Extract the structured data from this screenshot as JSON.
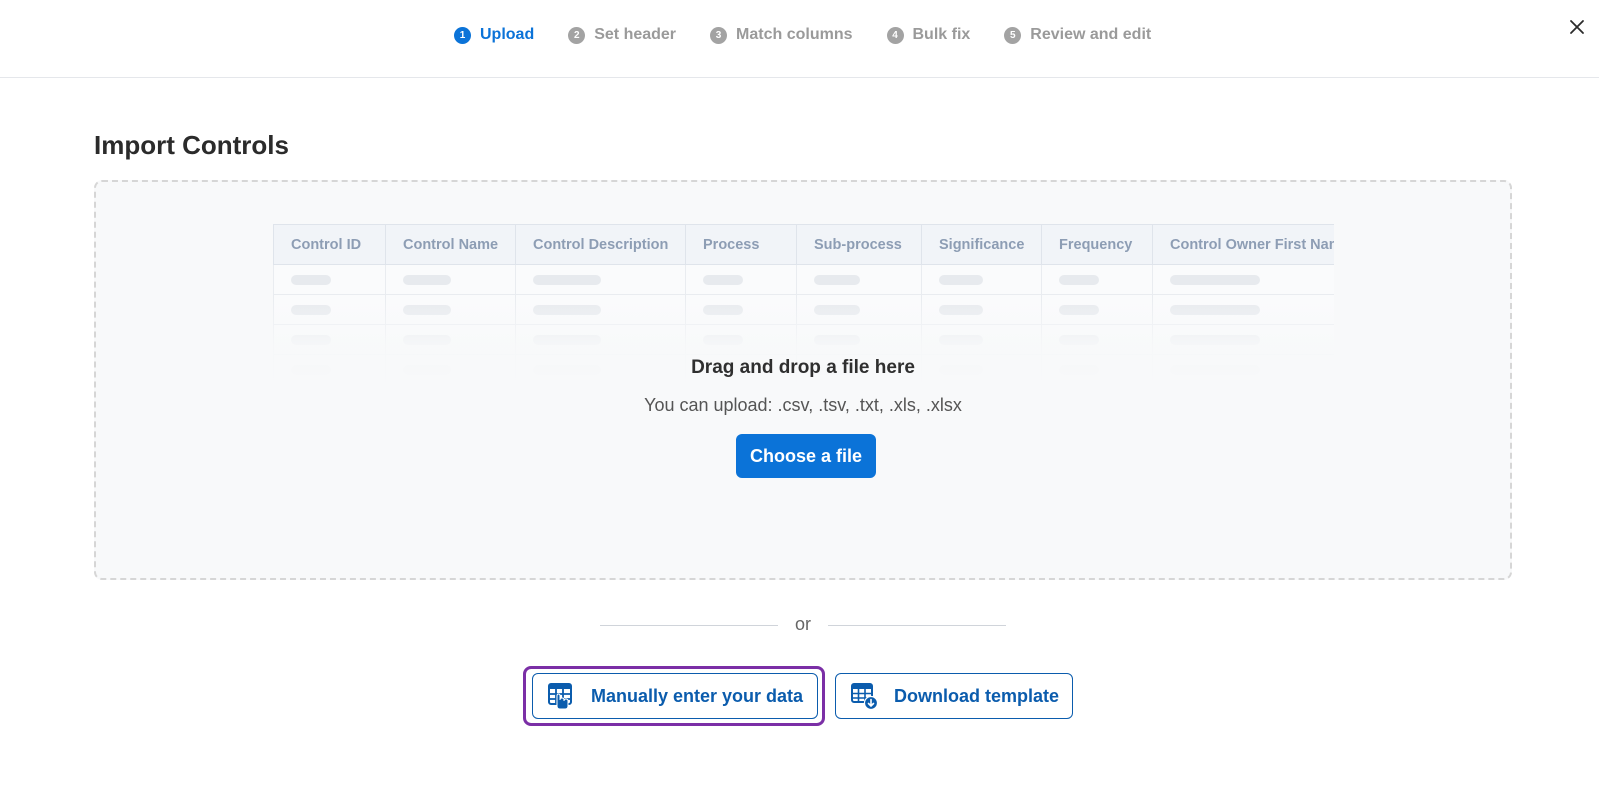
{
  "stepper": {
    "steps": [
      {
        "num": "1",
        "label": "Upload"
      },
      {
        "num": "2",
        "label": "Set header"
      },
      {
        "num": "3",
        "label": "Match columns"
      },
      {
        "num": "4",
        "label": "Bulk fix"
      },
      {
        "num": "5",
        "label": "Review and edit"
      }
    ],
    "active_step": 1
  },
  "page": {
    "title": "Import Controls"
  },
  "dropzone": {
    "title": "Drag and drop a file here",
    "subtitle": "You can upload: .csv, .tsv, .txt, .xls, .xlsx",
    "choose_button": "Choose a file",
    "preview_columns": [
      "Control ID",
      "Control Name",
      "Control Description",
      "Process",
      "Sub-process",
      "Significance",
      "Frequency",
      "Control Owner First Name"
    ]
  },
  "divider": {
    "text": "or"
  },
  "actions": {
    "manual_label": "Manually enter your data",
    "download_label": "Download template"
  },
  "icons": {
    "close": "close-icon",
    "manual": "table-hand-icon",
    "download": "table-download-icon"
  },
  "colors": {
    "primary": "#0b73d8",
    "outline_button": "#0b5cad",
    "focus_ring": "#7b2fa6",
    "inactive_step": "#9a9a9a"
  }
}
